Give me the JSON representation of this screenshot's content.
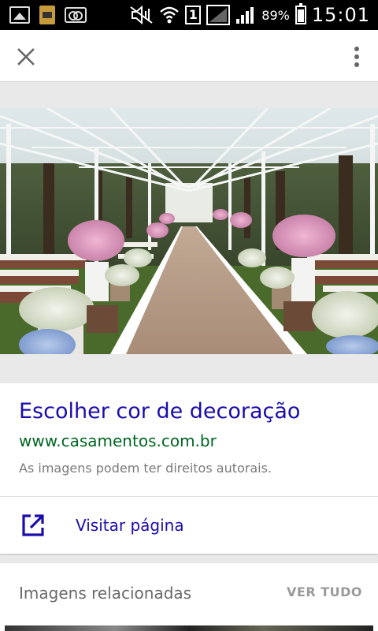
{
  "status_bar": {
    "battery_percent": "89%",
    "sim_slot": "1",
    "time": "15:01"
  },
  "app_bar": {
    "close_icon": "close-icon",
    "menu_icon": "more-vert-icon"
  },
  "result": {
    "title": "Escolher cor de decoração",
    "url": "www.casamentos.com.br",
    "rights_notice": "As imagens podem ter direitos autorais.",
    "visit_label": "Visitar página",
    "visit_icon": "open-in-new-icon"
  },
  "related": {
    "title": "Imagens relacionadas",
    "see_all": "VER TUDO"
  },
  "colors": {
    "link": "#1a0dab",
    "url": "#006621",
    "muted": "#7a7a7a"
  }
}
